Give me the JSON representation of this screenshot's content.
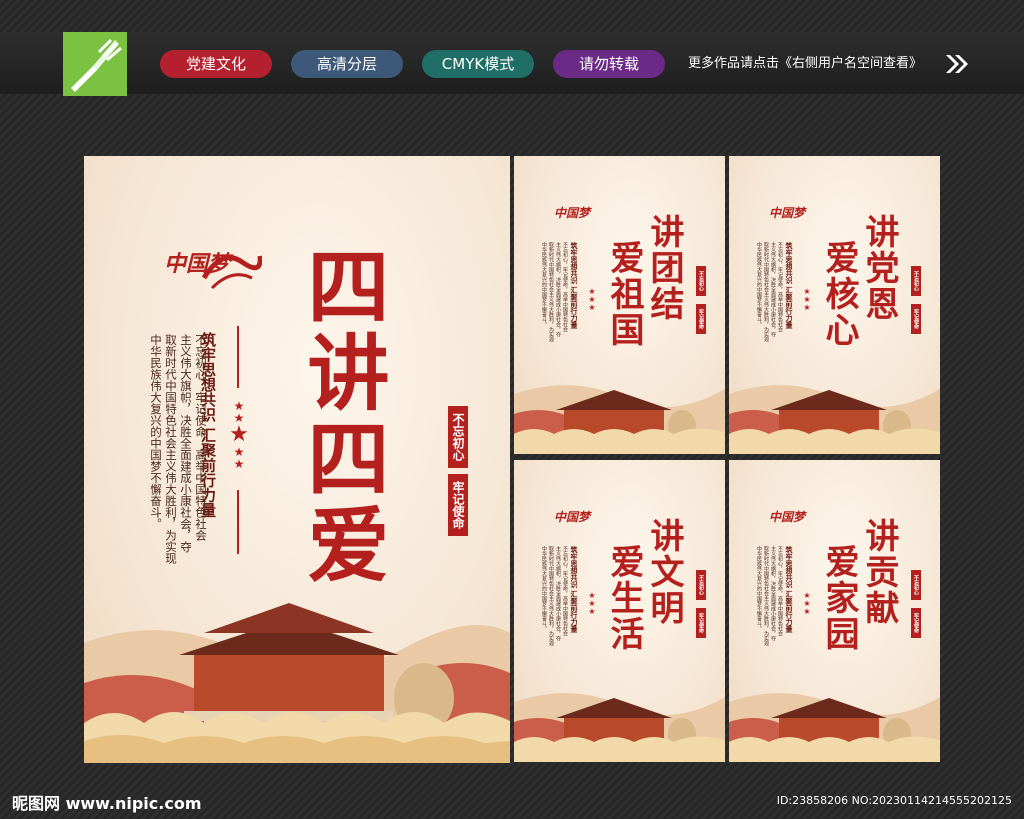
{
  "header": {
    "tags": [
      {
        "label": "党建文化",
        "color": "#b4202d"
      },
      {
        "label": "高清分层",
        "color": "#3d5878"
      },
      {
        "label": "CMYK模式",
        "color": "#1f6f67"
      },
      {
        "label": "请勿转载",
        "color": "#6a2a86"
      }
    ],
    "notice": "更多作品请点击《右侧用户名空间查看》"
  },
  "footer": {
    "site": "昵图网 www.nipic.com",
    "id_text": "ID:23858206 NO:20230114214555202125"
  },
  "colors": {
    "accent_red": "#b4201e",
    "logo_green": "#7cc242"
  },
  "common": {
    "calligraphy": "中国梦",
    "subtitle": "筑牢思想共识  汇聚前行力量",
    "body_lines": [
      "不忘初心，牢记使命，高举中国特色社会",
      "主义伟大旗帜，决胜全面建成小康社会，夺",
      "取新时代中国特色社会主义伟大胜利，为实现",
      "中华民族伟大复兴的中国梦不懈奋斗。"
    ],
    "seal_1": "不忘初心",
    "seal_2": "牢记使命"
  },
  "main_poster": {
    "title": "四讲四爱"
  },
  "small_posters": [
    {
      "line1": "讲团结",
      "line2": "爱祖国"
    },
    {
      "line1": "讲党恩",
      "line2": "爱核心"
    },
    {
      "line1": "讲文明",
      "line2": "爱生活"
    },
    {
      "line1": "讲贡献",
      "line2": "爱家园"
    }
  ]
}
